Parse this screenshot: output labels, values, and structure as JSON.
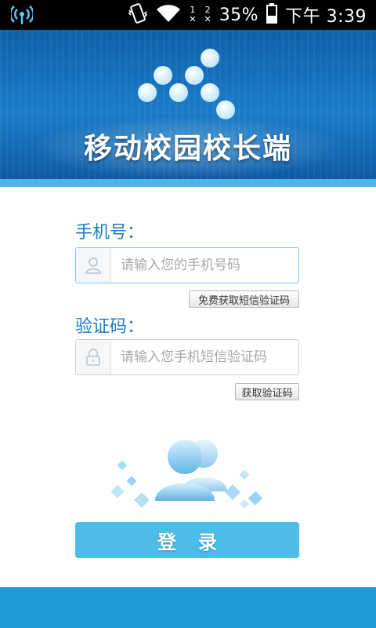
{
  "status_bar": {
    "battery": "35%",
    "time": "下午 3:39",
    "sim1": "1",
    "sim2": "2",
    "icons": [
      "wifi-hotspot-icon",
      "vibrate-icon",
      "wifi-icon",
      "no-signal-sim1-icon",
      "no-signal-sim2-icon",
      "battery-icon"
    ]
  },
  "header": {
    "app_title": "移动校园校长端"
  },
  "form": {
    "phone_label": "手机号：",
    "phone_placeholder": "请输入您的手机号码",
    "phone_value": "",
    "get_free_code_button": "免费获取短信验证码",
    "code_label": "验证码：",
    "code_placeholder": "请输入您手机短信验证码",
    "code_value": "",
    "get_code_button": "获取验证码",
    "login_button": "登录"
  },
  "colors": {
    "header_blue": "#1b7cc9",
    "accent_blue": "#4cbde9",
    "label_blue": "#1a7cc4",
    "bottom_blue": "#1e9ad8"
  }
}
